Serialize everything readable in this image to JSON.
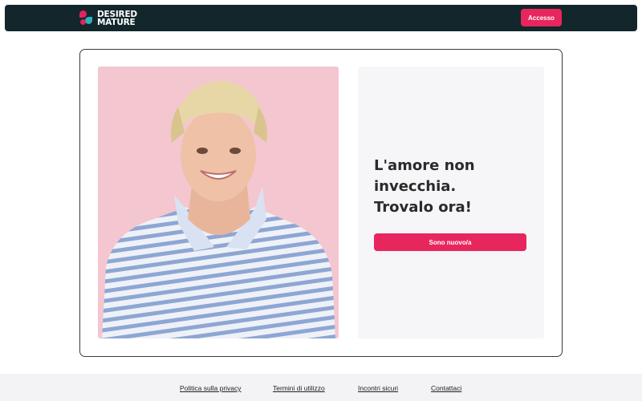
{
  "header": {
    "logo": {
      "line1": "DESIRED",
      "line2": "MATURE"
    },
    "login_label": "Accesso"
  },
  "hero": {
    "headline": [
      "L'amore non",
      "invecchia.",
      "Trovalo ora!"
    ],
    "signup_label": "Sono nuovo/a"
  },
  "footer": {
    "links": [
      "Politica sulla privacy",
      "Termini di utilizzo",
      "Incontri sicuri",
      "Contattaci"
    ]
  },
  "colors": {
    "topbar": "#12262b",
    "accent": "#e8265e",
    "photo_background": "#f4c6cf",
    "panel_background": "#f6f5f7"
  }
}
